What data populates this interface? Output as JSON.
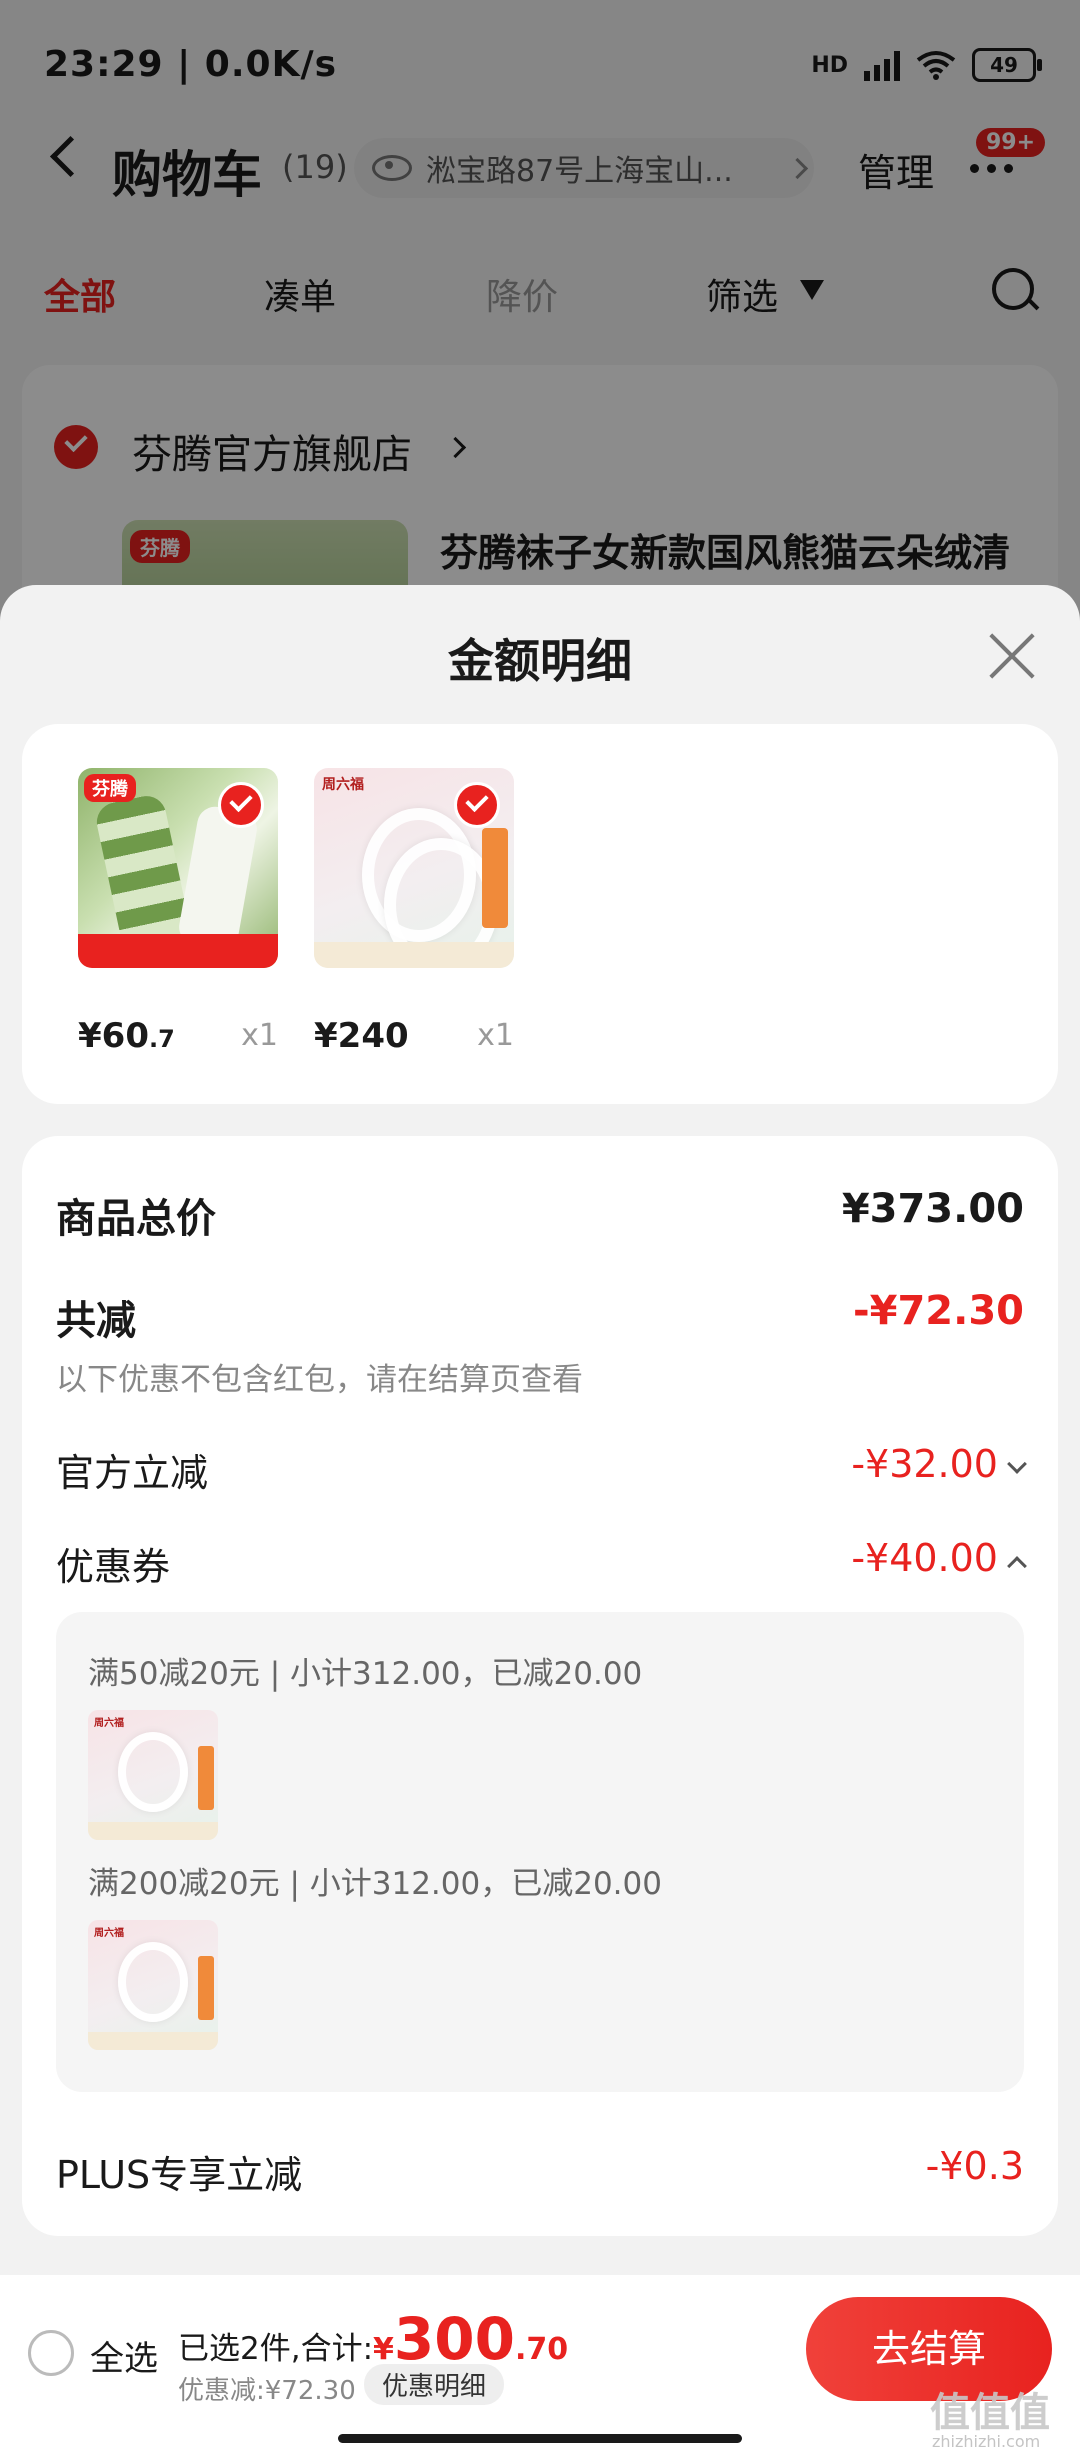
{
  "status_bar": {
    "time": "23:29 | 0.0K/s",
    "network_label": "HD",
    "battery": "49"
  },
  "header": {
    "title": "购物车",
    "count": "(19)",
    "address": "淞宝路87号上海宝山...",
    "manage_label": "管理",
    "more_badge": "99+"
  },
  "tabs": [
    {
      "label": "全部",
      "active": true
    },
    {
      "label": "凑单",
      "active": false
    },
    {
      "label": "降价",
      "active": false
    },
    {
      "label": "筛选",
      "active": false
    }
  ],
  "store": {
    "name": "芬腾官方旗舰店",
    "product_name": "芬腾袜子女新款国风熊猫云朵绒清",
    "logo_text": "芬腾"
  },
  "sheet": {
    "title": "金额明细",
    "items": [
      {
        "price_main": "¥60",
        "price_decimal": ".7",
        "qty": "x1",
        "brand": "芬腾"
      },
      {
        "price_main": "¥240",
        "price_decimal": "",
        "qty": "x1",
        "brand": "周六福"
      }
    ],
    "total_label": "商品总价",
    "total_value": "¥373.00",
    "reduce_label": "共减",
    "reduce_value": "-¥72.30",
    "reduce_note": "以下优惠不包含红包，请在结算页查看",
    "official_label": "官方立减",
    "official_value": "-¥32.00",
    "coupon_label": "优惠券",
    "coupon_value": "-¥40.00",
    "coupons": [
      {
        "text": "满50减20元 | 小计312.00，已减20.00"
      },
      {
        "text": "满200减20元 | 小计312.00，已减20.00"
      }
    ],
    "plus_label": "PLUS专享立减",
    "plus_value": "-¥0.3"
  },
  "bottom_bar": {
    "select_all_label": "全选",
    "selected_text": "已选2件,合计:",
    "total_currency": "¥",
    "total_int": "300",
    "total_dec": ".70",
    "discount_text": "优惠减:¥72.30",
    "detail_tag": "优惠明细",
    "checkout_label": "去结算"
  },
  "watermark": {
    "text": "值值值",
    "url": "zhizhizhi.com"
  },
  "colors": {
    "accent": "#e8221f",
    "sheet_bg": "#f2f2f2"
  }
}
